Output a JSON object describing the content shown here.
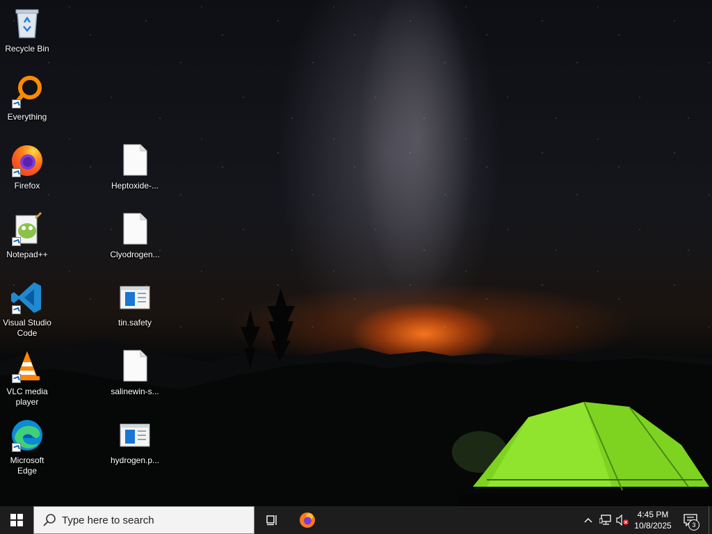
{
  "desktop": {
    "icons_left": [
      {
        "label": "Recycle Bin",
        "icon": "recycle-bin-icon"
      },
      {
        "label": "Everything",
        "icon": "everything-search-icon"
      },
      {
        "label": "Firefox",
        "icon": "firefox-icon"
      },
      {
        "label": "Notepad++",
        "icon": "notepad-plus-plus-icon"
      },
      {
        "label": "Visual Studio Code",
        "icon": "vscode-icon"
      },
      {
        "label": "VLC media player",
        "icon": "vlc-icon"
      },
      {
        "label": "Microsoft Edge",
        "icon": "edge-icon"
      }
    ],
    "icons_right": [
      {
        "label": "Heptoxide-...",
        "icon": "blank-file-icon"
      },
      {
        "label": "Clyodrogen...",
        "icon": "blank-file-icon"
      },
      {
        "label": "tin.safety",
        "icon": "window-file-icon"
      },
      {
        "label": "salinewin-s...",
        "icon": "blank-file-icon"
      },
      {
        "label": "hydrogen.p...",
        "icon": "window-file-icon"
      }
    ]
  },
  "taskbar": {
    "start_icon": "windows-logo-icon",
    "search_placeholder": "Type here to search",
    "task_view_icon": "task-view-icon",
    "pinned_app_icon": "firefox-icon",
    "tray": {
      "chevron_icon": "chevron-up-icon",
      "network_icon": "network-icon",
      "volume_icon": "volume-muted-icon",
      "time": "4:45 PM",
      "date": "10/8/2025",
      "notification_icon": "action-center-icon",
      "notification_count": "3"
    }
  },
  "colors": {
    "taskbar_bg": "#1d1d1d",
    "search_bg": "#f3f3f3",
    "accent_blue": "#0078d7"
  }
}
